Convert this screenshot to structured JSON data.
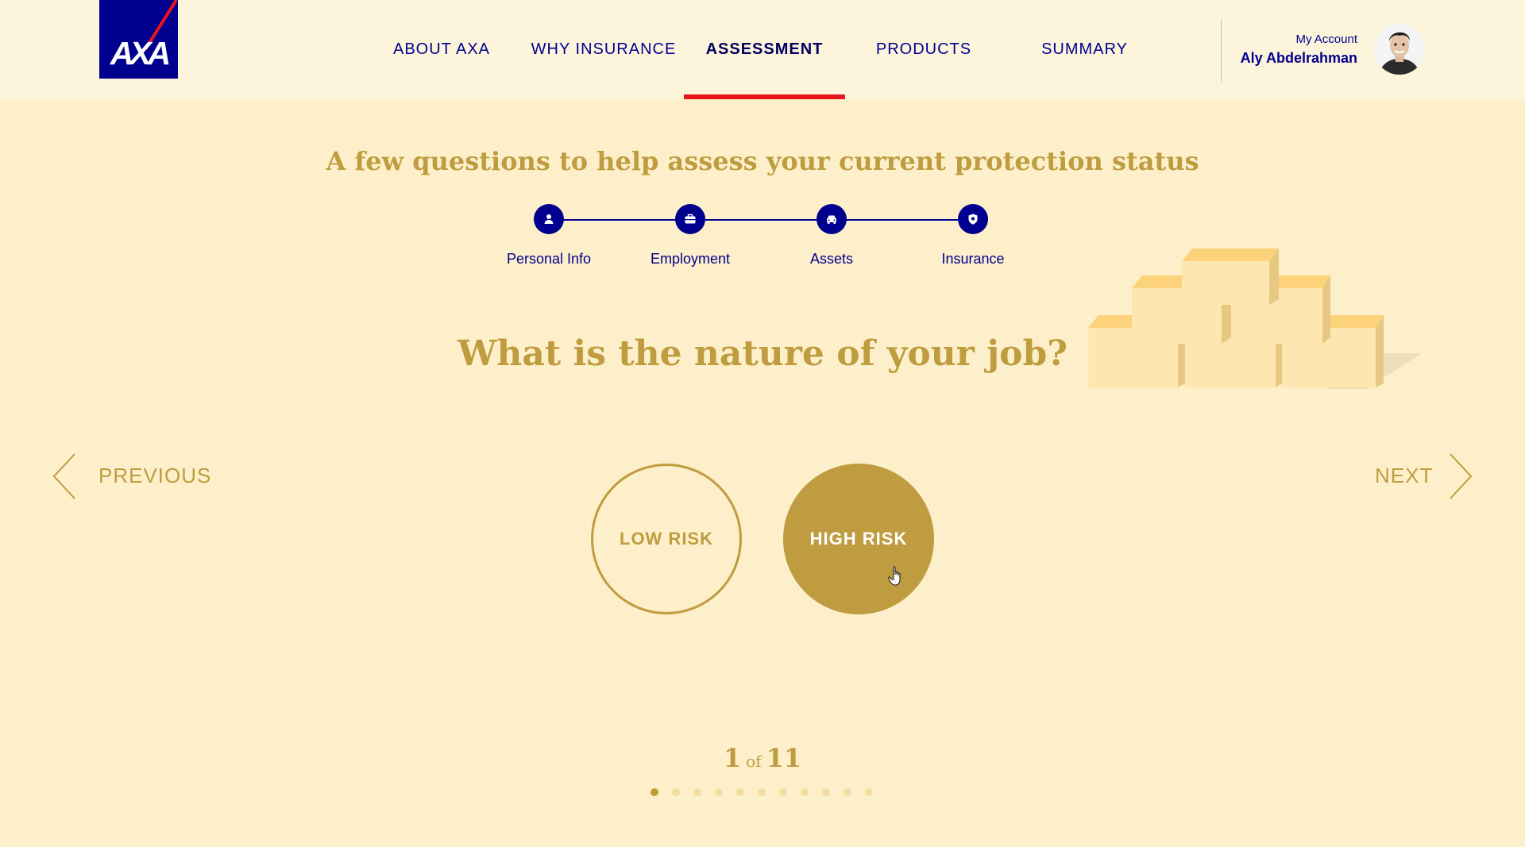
{
  "brand": {
    "logo_text": "AXA"
  },
  "nav": {
    "items": [
      {
        "label": "ABOUT AXA"
      },
      {
        "label": "WHY INSURANCE"
      },
      {
        "label": "ASSESSMENT"
      },
      {
        "label": "PRODUCTS"
      },
      {
        "label": "SUMMARY"
      }
    ],
    "active_index": 2
  },
  "account": {
    "link_label": "My Account",
    "user_name": "Aly Abdelrahman"
  },
  "assessment": {
    "subtitle": "A few questions to help assess your current protection status",
    "steps": [
      {
        "label": "Personal Info",
        "icon": "person-icon"
      },
      {
        "label": "Employment",
        "icon": "briefcase-icon"
      },
      {
        "label": "Assets",
        "icon": "car-icon"
      },
      {
        "label": "Insurance",
        "icon": "shield-icon"
      }
    ],
    "question": "What is the nature of your job?",
    "options": [
      {
        "label": "LOW RISK",
        "selected": false
      },
      {
        "label": "HIGH RISK",
        "selected": true
      }
    ],
    "previous_label": "PREVIOUS",
    "next_label": "NEXT",
    "progress": {
      "current": "1",
      "of_label": "of",
      "total": "11"
    },
    "page_count": 11,
    "active_page": 1
  },
  "colors": {
    "axa_blue": "#00008f",
    "gold": "#be9c3f",
    "background": "#fdefc9",
    "header_bg": "#fdf4dc",
    "accent_red": "#e8141e"
  }
}
